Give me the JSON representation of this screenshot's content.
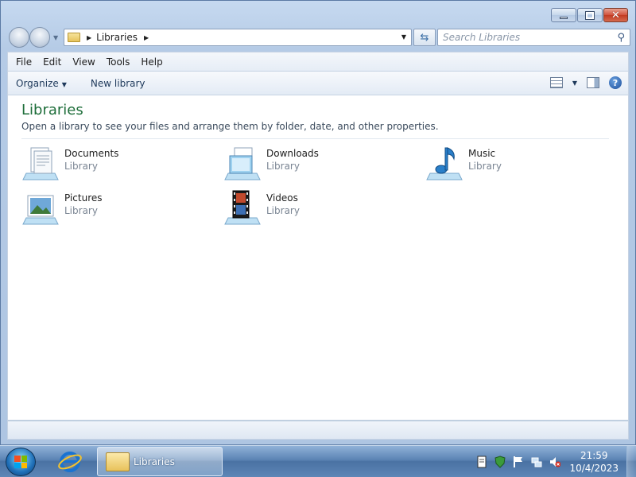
{
  "window": {
    "minimize_label": "",
    "maximize_label": "",
    "close_label": ""
  },
  "address": {
    "path": "Libraries",
    "search_placeholder": "Search Libraries"
  },
  "menu": [
    "File",
    "Edit",
    "View",
    "Tools",
    "Help"
  ],
  "toolbar": {
    "organize": "Organize",
    "new_library": "New library"
  },
  "content": {
    "title": "Libraries",
    "description": "Open a library to see your files and arrange them by folder, date, and other properties.",
    "libraries": [
      {
        "name": "Documents",
        "kind": "Library",
        "icon": "documents-library-icon"
      },
      {
        "name": "Downloads",
        "kind": "Library",
        "icon": "downloads-library-icon"
      },
      {
        "name": "Music",
        "kind": "Library",
        "icon": "music-library-icon"
      },
      {
        "name": "Pictures",
        "kind": "Library",
        "icon": "pictures-library-icon"
      },
      {
        "name": "Videos",
        "kind": "Library",
        "icon": "videos-library-icon"
      }
    ]
  },
  "taskbar": {
    "active_window": "Libraries",
    "time": "21:59",
    "date": "10/4/2023"
  }
}
